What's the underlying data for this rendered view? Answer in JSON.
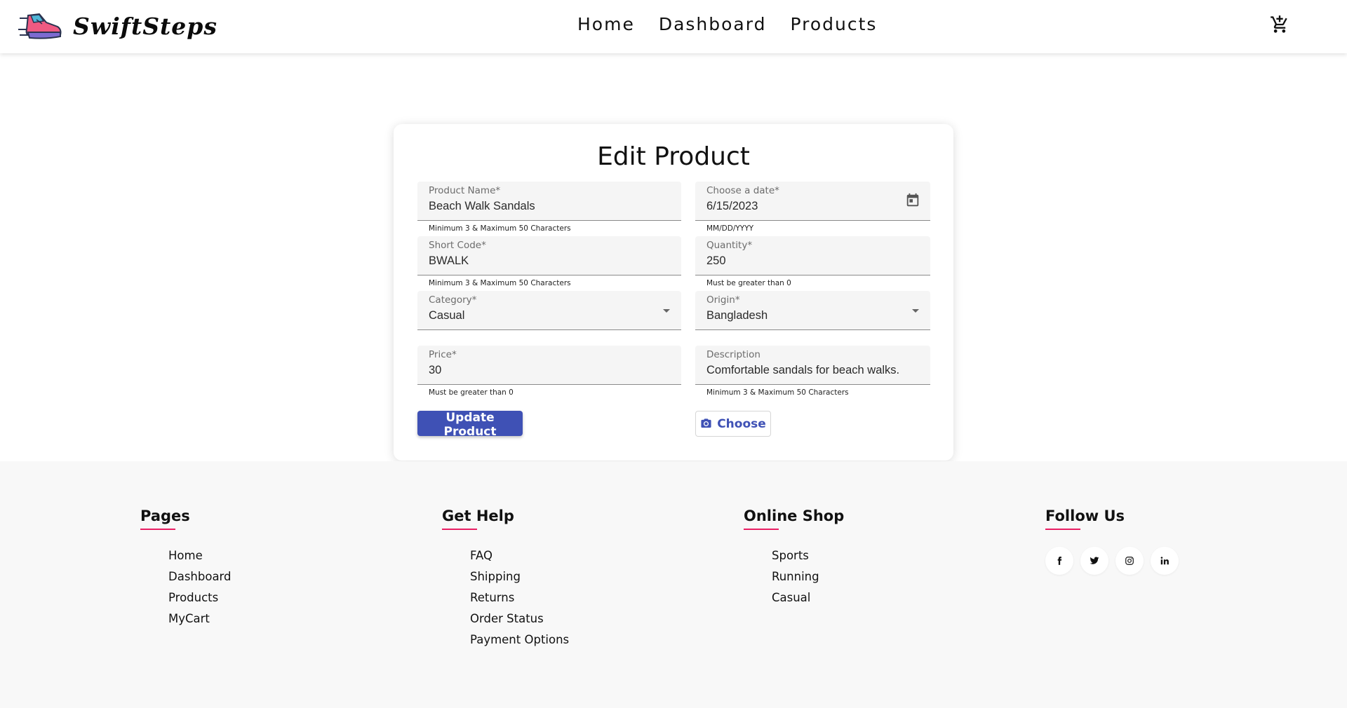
{
  "header": {
    "brand": "SwiftSteps",
    "nav": [
      "Home",
      "Dashboard",
      "Products"
    ],
    "icons": {
      "logo": "sneaker-logo",
      "cart": "cart-icon"
    }
  },
  "form": {
    "title": "Edit Product",
    "product_name": {
      "label": "Product Name",
      "required": "*",
      "value": "Beach Walk Sandals",
      "hint": "Minimum 3 & Maximum 50 Characters"
    },
    "date": {
      "label": "Choose a date",
      "required": "*",
      "value": "6/15/2023",
      "hint": "MM/DD/YYYY"
    },
    "short_code": {
      "label": "Short Code",
      "required": "*",
      "value": "BWALK",
      "hint": "Minimum 3 & Maximum 50 Characters"
    },
    "quantity": {
      "label": "Quantity",
      "required": "*",
      "value": "250",
      "hint": "Must be greater than 0"
    },
    "category": {
      "label": "Category",
      "required": "*",
      "value": "Casual"
    },
    "origin": {
      "label": "Origin",
      "required": "*",
      "value": "Bangladesh"
    },
    "price": {
      "label": "Price",
      "required": "*",
      "value": "30",
      "hint": "Must be greater than 0"
    },
    "description": {
      "label": "Description",
      "value": "Comfortable sandals for beach walks.",
      "hint": "Minimum 3 & Maximum 50 Characters"
    },
    "update_button": "Update Product",
    "choose_button": "Choose"
  },
  "footer": {
    "pages": {
      "heading": "Pages",
      "items": [
        "Home",
        "Dashboard",
        "Products",
        "MyCart"
      ]
    },
    "help": {
      "heading": "Get Help",
      "items": [
        "FAQ",
        "Shipping",
        "Returns",
        "Order Status",
        "Payment Options"
      ]
    },
    "shop": {
      "heading": "Online Shop",
      "items": [
        "Sports",
        "Running",
        "Casual"
      ]
    },
    "follow": {
      "heading": "Follow Us",
      "icons": [
        "facebook-icon",
        "twitter-icon",
        "instagram-icon",
        "linkedin-icon"
      ]
    }
  },
  "colors": {
    "primary": "#3f51b5",
    "accent_underline": "#e91e63",
    "footer_bg": "#f8f8f8",
    "field_bg": "#f5f5f5"
  }
}
